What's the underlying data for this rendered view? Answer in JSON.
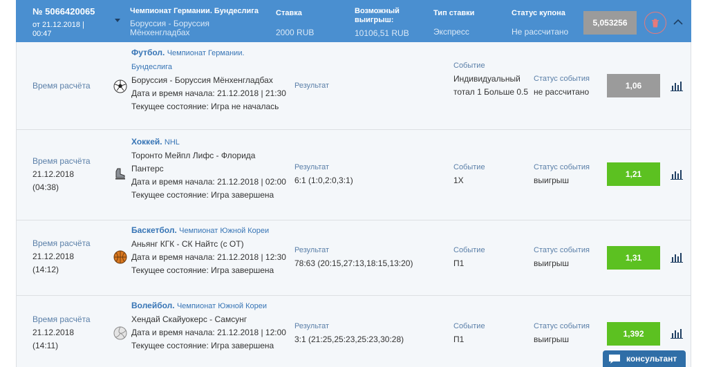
{
  "coupon": {
    "number": "№ 5066420065",
    "date": "от 21.12.2018 | 00:47",
    "championship": "Чемпионат Германии. Бундеслига",
    "match": "Боруссия - Боруссия Мёнхенгладбах",
    "stake_label": "Ставка",
    "stake_value": "2000 RUB",
    "win_label": "Возможный выигрыш:",
    "win_value": "10106,51 RUB",
    "type_label": "Тип ставки",
    "type_value": "Экспресс",
    "status_label": "Статус купона",
    "status_value": "Не рассчитано",
    "total_coef": "5,053256"
  },
  "labels": {
    "calc_time": "Время расчёта",
    "result": "Результат",
    "event": "Событие",
    "event_status": "Статус события",
    "start_prefix": "Дата и время начала:",
    "state_prefix": "Текущее состояние:"
  },
  "rows": [
    {
      "calc_date": "",
      "calc_time": "",
      "sport": "Футбол.",
      "league": "Чемпионат Германии. Бундеслига",
      "teams": "Боруссия - Боруссия Мёнхенгладбах",
      "start": "21.12.2018 | 21:30",
      "state": "Игра не началась",
      "result": "",
      "event": "Индивидуальный тотал 1 Больше 0.5",
      "status": "не рассчитано",
      "coef": "1,06",
      "coef_color": "#9b9b9b",
      "icon": "soccer-ball-icon"
    },
    {
      "calc_date": "21.12.2018",
      "calc_time": "(04:38)",
      "sport": "Хоккей.",
      "league": "NHL",
      "teams": "Торонто Мейпл Лифс - Флорида Пантерс",
      "start": "21.12.2018 | 02:00",
      "state": "Игра завершена",
      "result": "6:1 (1:0,2:0,3:1)",
      "event": "1X",
      "status": "выигрыш",
      "coef": "1,21",
      "coef_color": "#5cc121",
      "icon": "hockey-skate-icon"
    },
    {
      "calc_date": "21.12.2018",
      "calc_time": "(14:12)",
      "sport": "Баскетбол.",
      "league": "Чемпионат Южной Кореи",
      "teams": "Аньянг КГК - СК Найтс (с ОТ)",
      "start": "21.12.2018 | 12:30",
      "state": "Игра завершена",
      "result": "78:63 (20:15,27:13,18:15,13:20)",
      "event": "П1",
      "status": "выигрыш",
      "coef": "1,31",
      "coef_color": "#5cc121",
      "icon": "basketball-icon"
    },
    {
      "calc_date": "21.12.2018",
      "calc_time": "(14:11)",
      "sport": "Волейбол.",
      "league": "Чемпионат Южной Кореи",
      "teams": "Хендай Скайуокерс - Самсунг",
      "start": "21.12.2018 | 12:00",
      "state": "Игра завершена",
      "result": "3:1 (21:25,25:23,25:23,30:28)",
      "event": "П1",
      "status": "выигрыш",
      "coef": "1,392",
      "coef_color": "#5cc121",
      "icon": "volleyball-icon"
    }
  ],
  "consultant": "консультант"
}
